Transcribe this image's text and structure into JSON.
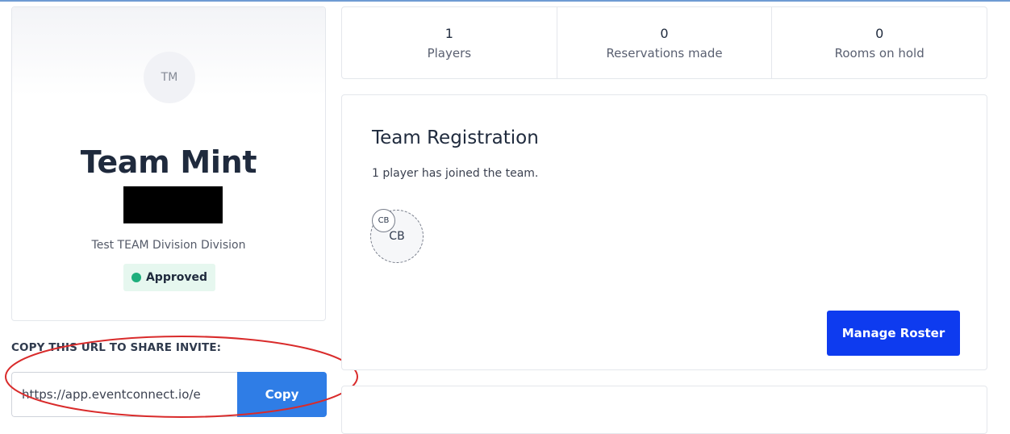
{
  "team": {
    "initials": "TM",
    "name": "Team Mint",
    "division": "Test TEAM Division Division",
    "status": "Approved"
  },
  "share": {
    "label": "COPY THIS URL TO SHARE INVITE:",
    "url": "https://app.eventconnect.io/e",
    "copy_label": "Copy"
  },
  "stats": [
    {
      "value": "1",
      "label": "Players"
    },
    {
      "value": "0",
      "label": "Reservations made"
    },
    {
      "value": "0",
      "label": "Rooms on hold"
    }
  ],
  "registration": {
    "title": "Team Registration",
    "subtitle": "1 player has joined the team.",
    "player_initials": "CB",
    "player_chip": "CB",
    "manage_label": "Manage Roster"
  },
  "colors": {
    "approved": "#1eae7c",
    "primary_button": "#0e3bef",
    "copy_button": "#2f7de6",
    "annotation": "#d92b2b"
  }
}
